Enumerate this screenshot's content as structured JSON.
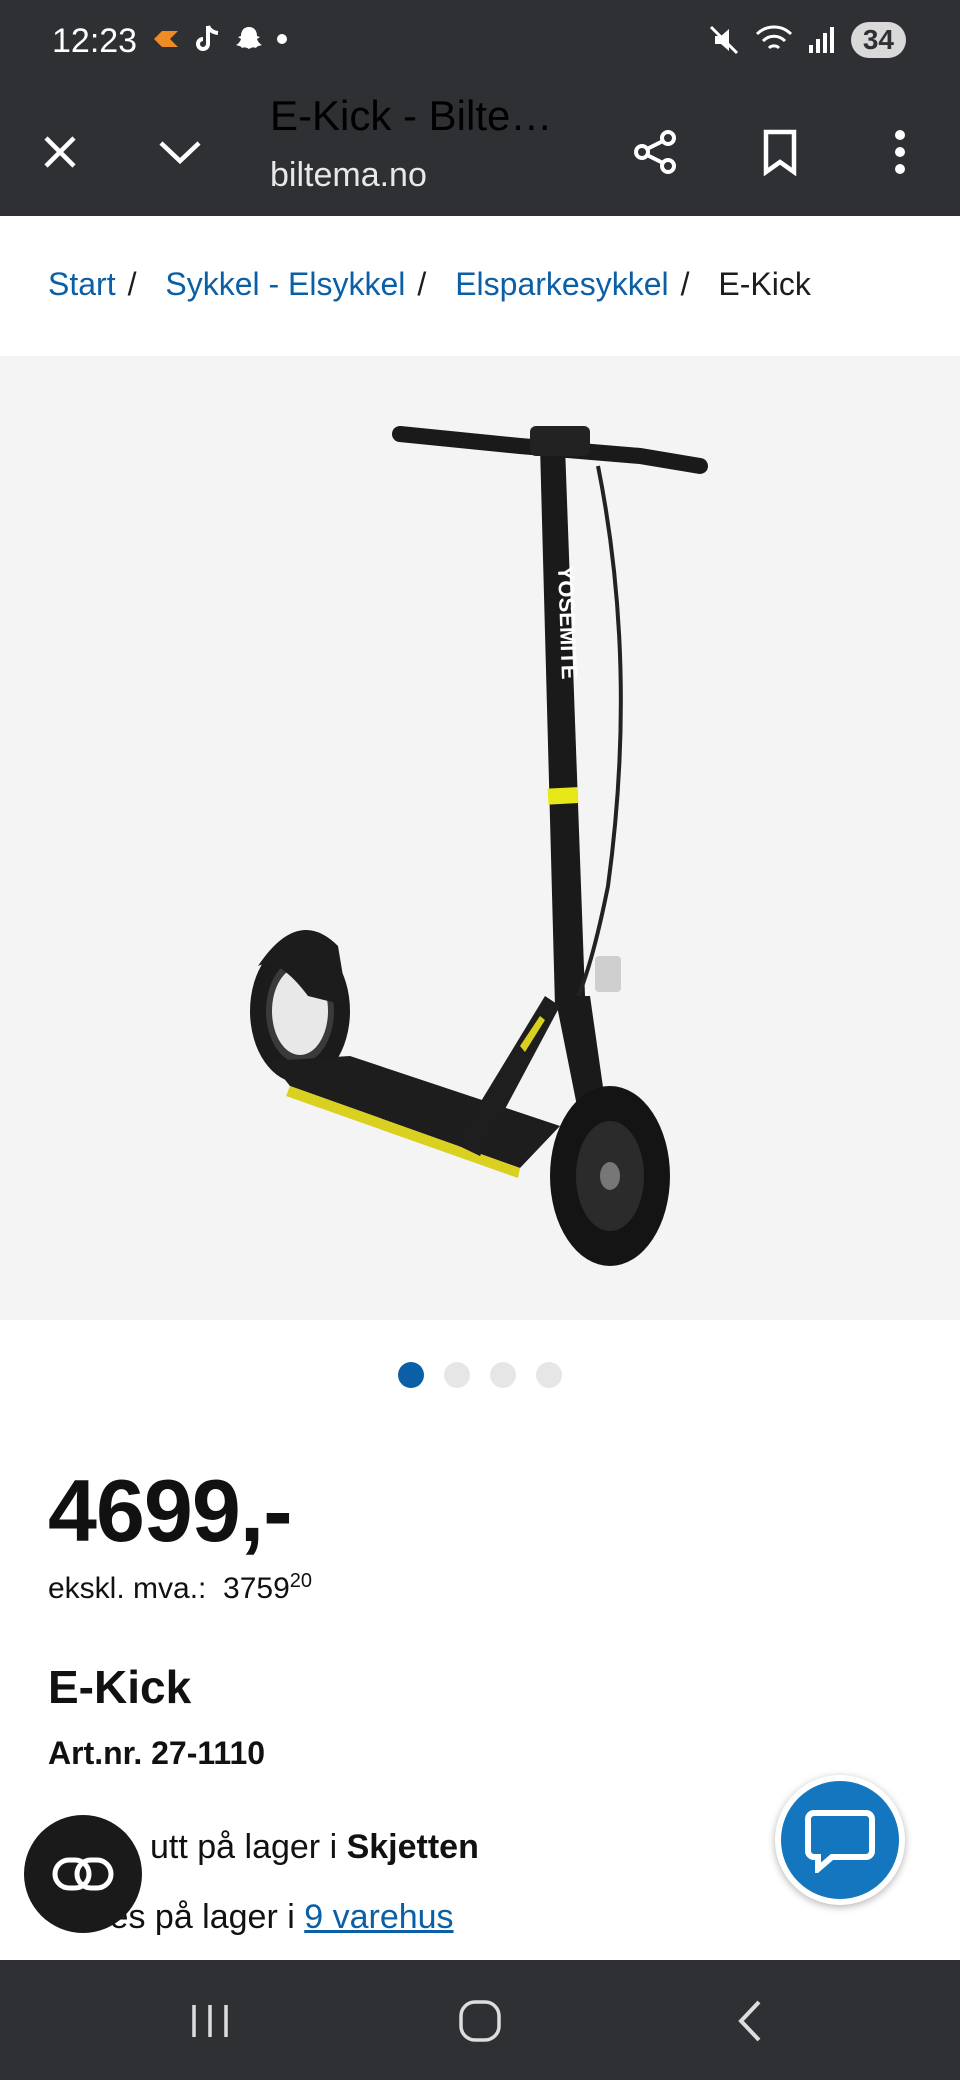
{
  "status": {
    "time": "12:23",
    "battery": "34"
  },
  "toolbar": {
    "title": "E-Kick - Bilte…",
    "url": "biltema.no"
  },
  "breadcrumb": {
    "items": [
      "Start",
      "Sykkel - Elsykkel",
      "Elsparkesykkel"
    ],
    "current": "E-Kick",
    "separator": "/"
  },
  "product": {
    "brand_on_image": "YOSEMITE",
    "price": "4699,-",
    "ex_vat_label": "ekskl. mva.:",
    "ex_vat_main": "3759",
    "ex_vat_cents": "20",
    "name": "E-Kick",
    "art_nr": "Art.nr. 27-1110",
    "stock_line1_prefix": "utt på lager i",
    "stock_line1_store": "Skjetten",
    "stock_line2_prefix": "les på lager i",
    "stock_line2_link": "9 varehus"
  },
  "carousel": {
    "count": 4,
    "active_index": 0
  },
  "colors": {
    "accent": "#0b5fa6",
    "chrome": "#2f3033",
    "chat_fab": "#1476be",
    "highlight": "#e6e81a"
  }
}
